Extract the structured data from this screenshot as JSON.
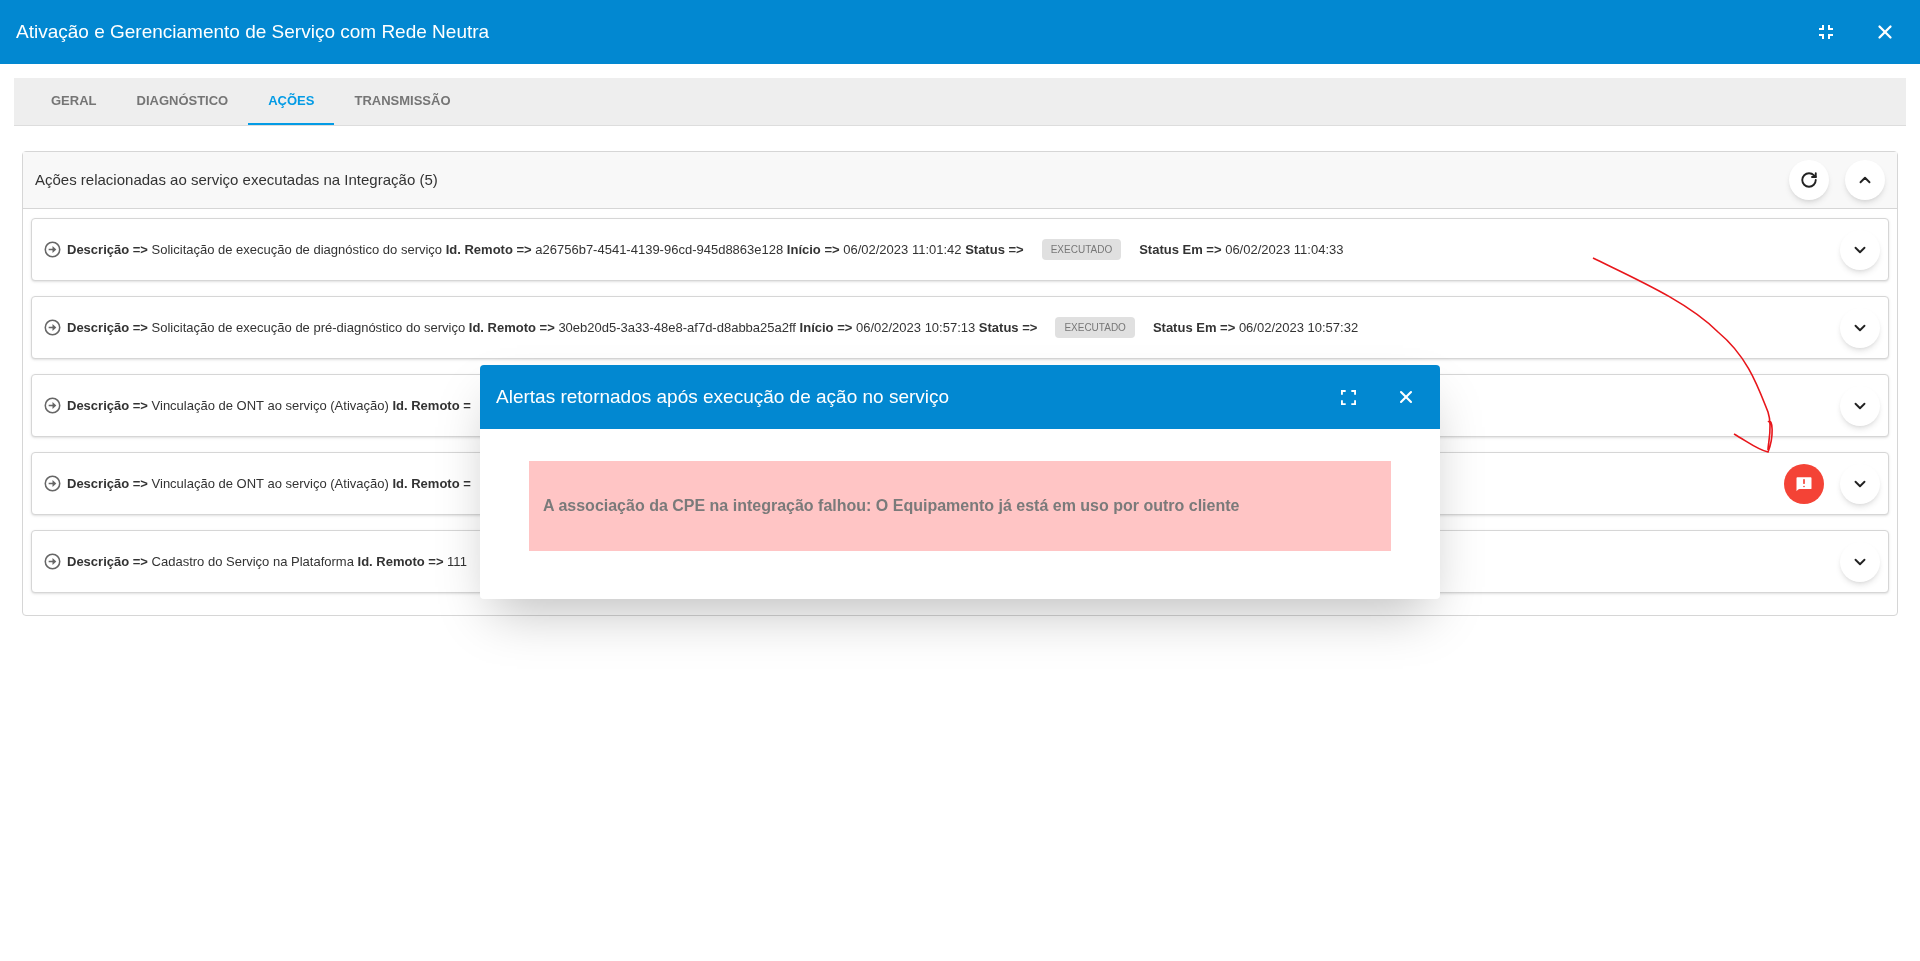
{
  "window": {
    "title": "Ativação e Gerenciamento de Serviço com Rede Neutra"
  },
  "tabs": [
    {
      "label": "GERAL",
      "selected": false
    },
    {
      "label": "DIAGNÓSTICO",
      "selected": false
    },
    {
      "label": "AÇÕES",
      "selected": true
    },
    {
      "label": "TRANSMISSÃO",
      "selected": false
    }
  ],
  "panel": {
    "title": "Ações relacionadas ao serviço executadas na Integração (5)",
    "expanded": true
  },
  "rows": [
    {
      "text": "**Descrição =>** Solicitação de execução de diagnóstico do serviço **Id. Remoto =>** a26756b7-4541-4139-96cd-945d8863e128 **Início =>** 06/02/2023 11:01:42 **Status =>**",
      "status": "EXECUTADO",
      "text_after": "**Status Em =>** 06/02/2023 11:04:33",
      "alert": false
    },
    {
      "text": "**Descrição =>** Solicitação de execução de pré-diagnóstico do serviço **Id. Remoto =>** 30eb20d5-3a33-48e8-af7d-d8abba25a2ff **Início =>** 06/02/2023 10:57:13 **Status =>**",
      "status": "EXECUTADO",
      "text_after": "**Status Em =>** 06/02/2023 10:57:32",
      "alert": false
    },
    {
      "text": "**Descrição =>** Vinculação de ONT ao serviço (Ativação) **Id. Remoto =**",
      "alert": false
    },
    {
      "text": "**Descrição =>** Vinculação de ONT ao serviço (Ativação) **Id. Remoto =**",
      "alert": true
    },
    {
      "text": "**Descrição =>** Cadastro do Serviço na Plataforma **Id. Remoto =>** 111",
      "alert": false
    }
  ],
  "dialog": {
    "title": "Alertas retornados após execução de ação no serviço",
    "alerts": [
      "A associação da CPE na integração falhou: O Equipamento já está em uso por outro cliente"
    ]
  }
}
